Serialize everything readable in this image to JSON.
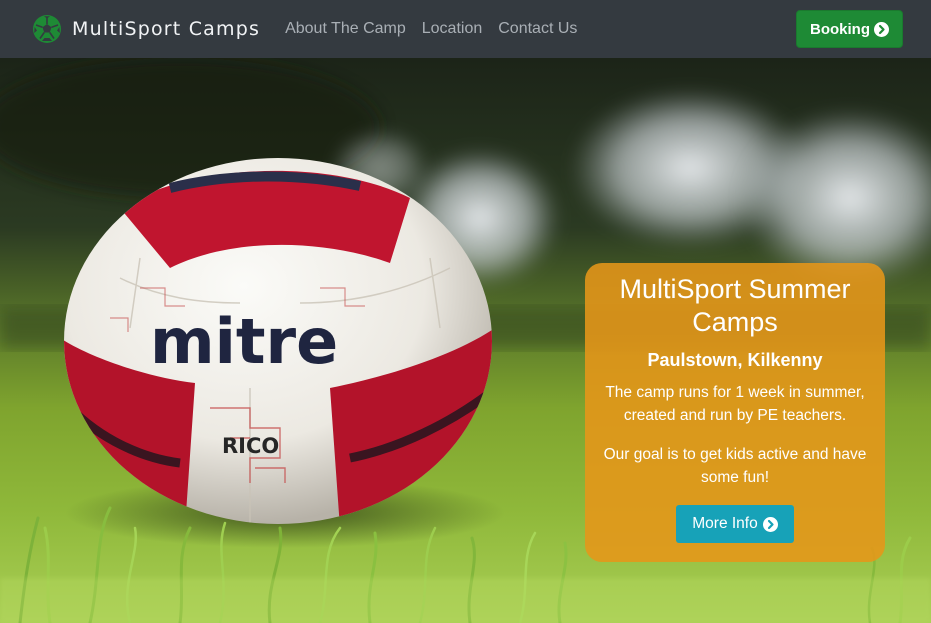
{
  "navbar": {
    "brand_name": "MultiSport Camps",
    "brand_icon": "soccer-ball-icon",
    "links": [
      "About The Camp",
      "Location",
      "Contact Us"
    ],
    "booking_label": "Booking",
    "colors": {
      "background": "#343a40",
      "brand_icon": "#1e8a35",
      "booking_button": "#1e8a35"
    }
  },
  "hero": {
    "image": "football-on-grass",
    "ball_text": {
      "brand": "mitre",
      "model": "RICO"
    }
  },
  "callout": {
    "title": "MultiSport Summer Camps",
    "location": "Paulstown, Kilkenny",
    "description": "The camp runs for 1 week in summer, created and run by PE teachers.",
    "goal": "Our goal is to get kids active and have some fun!",
    "button_label": "More Info",
    "colors": {
      "card": "#e69619",
      "button": "#17a2b8"
    }
  }
}
